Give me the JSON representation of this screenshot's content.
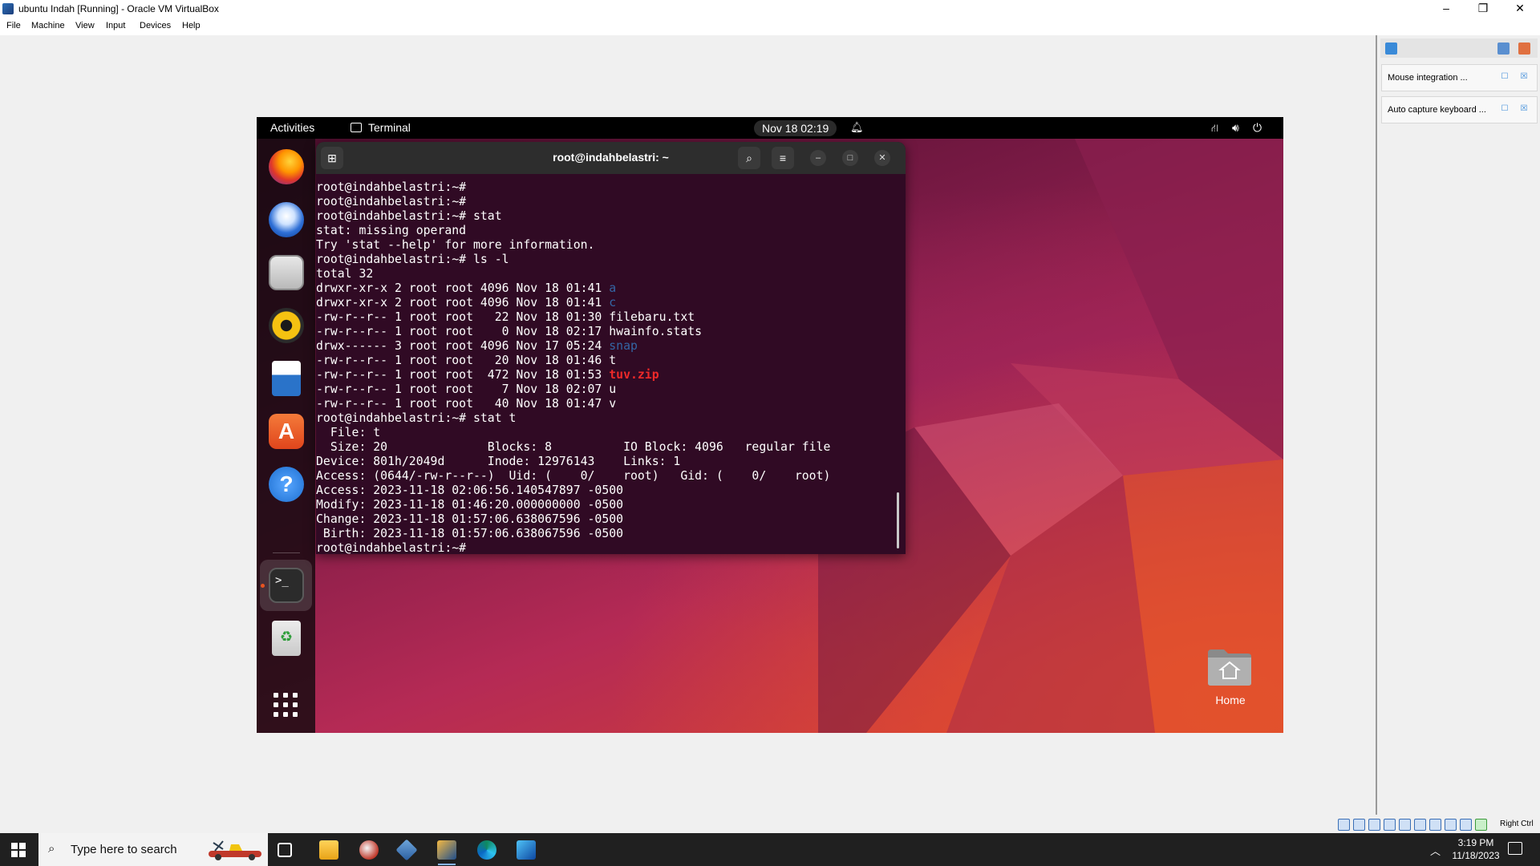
{
  "vbox": {
    "title": "ubuntu Indah [Running] - Oracle VM VirtualBox",
    "menu": [
      "File",
      "Machine",
      "View",
      "Input",
      "Devices",
      "Help"
    ],
    "window_controls": {
      "minimize": "–",
      "restore": "❐",
      "close": "✕"
    },
    "side_panel": {
      "cards": [
        {
          "label": "Mouse integration ..."
        },
        {
          "label": "Auto capture keyboard ..."
        }
      ]
    },
    "status": {
      "host_key": "Right Ctrl"
    }
  },
  "ubuntu": {
    "topbar": {
      "activities": "Activities",
      "app_label": "Terminal",
      "clock": "Nov 18  02:19"
    },
    "terminal": {
      "title": "root@indahbelastri: ~",
      "lines": [
        [
          {
            "t": "root@indahbelastri:~#"
          }
        ],
        [
          {
            "t": "root@indahbelastri:~#"
          }
        ],
        [
          {
            "t": "root@indahbelastri:~# stat"
          }
        ],
        [
          {
            "t": "stat: missing operand"
          }
        ],
        [
          {
            "t": "Try 'stat --help' for more information."
          }
        ],
        [
          {
            "t": "root@indahbelastri:~# ls -l"
          }
        ],
        [
          {
            "t": "total 32"
          }
        ],
        [
          {
            "t": "drwxr-xr-x 2 root root 4096 Nov 18 01:41 "
          },
          {
            "t": "a",
            "c": "blue"
          }
        ],
        [
          {
            "t": "drwxr-xr-x 2 root root 4096 Nov 18 01:41 "
          },
          {
            "t": "c",
            "c": "blue"
          }
        ],
        [
          {
            "t": "-rw-r--r-- 1 root root   22 Nov 18 01:30 filebaru.txt"
          }
        ],
        [
          {
            "t": "-rw-r--r-- 1 root root    0 Nov 18 02:17 hwainfo.stats"
          }
        ],
        [
          {
            "t": "drwx------ 3 root root 4096 Nov 17 05:24 "
          },
          {
            "t": "snap",
            "c": "blue"
          }
        ],
        [
          {
            "t": "-rw-r--r-- 1 root root   20 Nov 18 01:46 t"
          }
        ],
        [
          {
            "t": "-rw-r--r-- 1 root root  472 Nov 18 01:53 "
          },
          {
            "t": "tuv.zip",
            "c": "red"
          }
        ],
        [
          {
            "t": "-rw-r--r-- 1 root root    7 Nov 18 02:07 u"
          }
        ],
        [
          {
            "t": "-rw-r--r-- 1 root root   40 Nov 18 01:47 v"
          }
        ],
        [
          {
            "t": "root@indahbelastri:~# stat t"
          }
        ],
        [
          {
            "t": "  File: t"
          }
        ],
        [
          {
            "t": "  Size: 20              Blocks: 8          IO Block: 4096   regular file"
          }
        ],
        [
          {
            "t": "Device: 801h/2049d      Inode: 12976143    Links: 1"
          }
        ],
        [
          {
            "t": "Access: (0644/-rw-r--r--)  Uid: (    0/    root)   Gid: (    0/    root)"
          }
        ],
        [
          {
            "t": "Access: 2023-11-18 02:06:56.140547897 -0500"
          }
        ],
        [
          {
            "t": "Modify: 2023-11-18 01:46:20.000000000 -0500"
          }
        ],
        [
          {
            "t": "Change: 2023-11-18 01:57:06.638067596 -0500"
          }
        ],
        [
          {
            "t": " Birth: 2023-11-18 01:57:06.638067596 -0500"
          }
        ],
        [
          {
            "t": "root@indahbelastri:~#"
          }
        ]
      ]
    },
    "desktop": {
      "home_label": "Home"
    }
  },
  "taskbar": {
    "search_placeholder": "Type here to search",
    "time": "3:19 PM",
    "date": "11/18/2023"
  },
  "colors": {
    "terminal_bg": "#300a24",
    "ubuntu_orange": "#e95420",
    "ls_dir_blue": "#3465a4",
    "ls_archive_red": "#ef2929"
  }
}
